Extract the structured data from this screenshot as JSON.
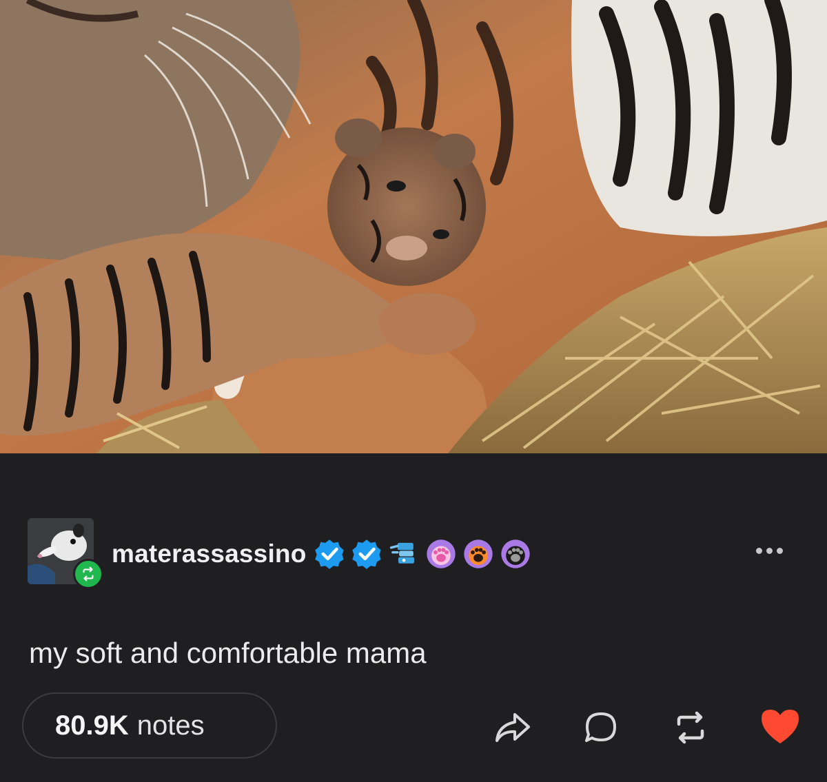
{
  "post": {
    "author": {
      "username": "materassassino"
    },
    "badges": [
      "verified-check-badge",
      "verified-check-badge",
      "blue-robot-badge",
      "pink-paw-badge",
      "orange-paw-badge",
      "dark-paw-badge"
    ],
    "caption": "my soft and comfortable mama",
    "notes": {
      "count": "80.9K",
      "label": "notes"
    }
  },
  "actions": [
    "share-icon",
    "comment-icon",
    "reblog-icon",
    "like-heart-icon"
  ],
  "colors": {
    "background": "#1f1f21",
    "verified": "#1d9bf0",
    "reblog_badge": "#1fb74e",
    "heart": "#ff4930",
    "text": "#e9e9ea"
  }
}
